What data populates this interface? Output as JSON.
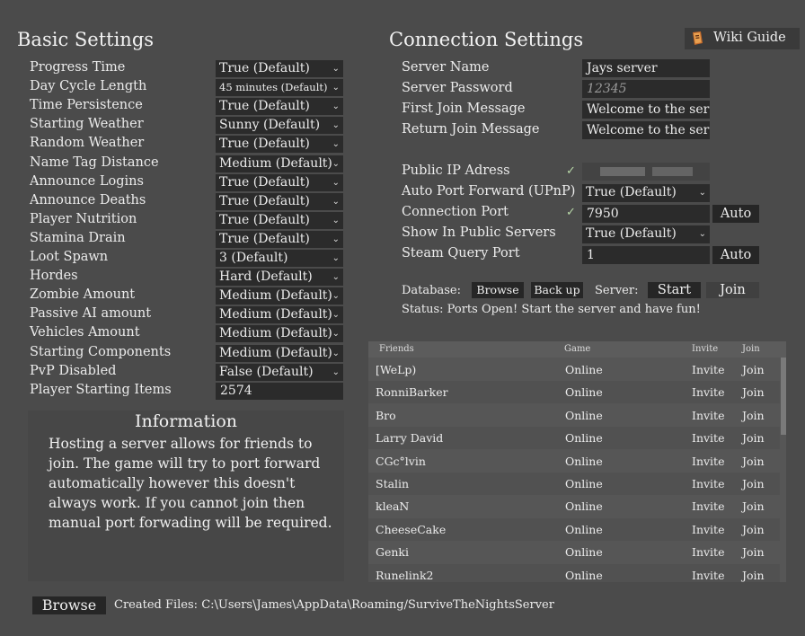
{
  "basic": {
    "title": "Basic Settings",
    "rows": [
      {
        "label": "Progress Time",
        "value": "True (Default)",
        "type": "dropdown"
      },
      {
        "label": "Day Cycle Length",
        "value": "45 minutes (Default)",
        "type": "dropdown",
        "small": true
      },
      {
        "label": "Time Persistence",
        "value": "True (Default)",
        "type": "dropdown"
      },
      {
        "label": "Starting Weather",
        "value": "Sunny (Default)",
        "type": "dropdown"
      },
      {
        "label": "Random Weather",
        "value": "True (Default)",
        "type": "dropdown"
      },
      {
        "label": "Name Tag Distance",
        "value": "Medium (Default)",
        "type": "dropdown"
      },
      {
        "label": "Announce Logins",
        "value": "True (Default)",
        "type": "dropdown"
      },
      {
        "label": "Announce Deaths",
        "value": "True (Default)",
        "type": "dropdown"
      },
      {
        "label": "Player Nutrition",
        "value": "True (Default)",
        "type": "dropdown"
      },
      {
        "label": "Stamina Drain",
        "value": "True (Default)",
        "type": "dropdown"
      },
      {
        "label": "Loot Spawn",
        "value": "3 (Default)",
        "type": "dropdown"
      },
      {
        "label": "Hordes",
        "value": "Hard (Default)",
        "type": "dropdown"
      },
      {
        "label": "Zombie Amount",
        "value": "Medium (Default)",
        "type": "dropdown"
      },
      {
        "label": "Passive AI amount",
        "value": "Medium (Default)",
        "type": "dropdown"
      },
      {
        "label": "Vehicles Amount",
        "value": "Medium (Default)",
        "type": "dropdown"
      },
      {
        "label": "Starting Components",
        "value": "Medium (Default)",
        "type": "dropdown"
      },
      {
        "label": "PvP Disabled",
        "value": "False (Default)",
        "type": "dropdown"
      },
      {
        "label": "Player Starting Items",
        "value": "2574",
        "type": "input"
      }
    ]
  },
  "info": {
    "title": "Information",
    "text": "Hosting a server allows for friends to join. The game will try to port forward automatically however this doesn't always work. If you cannot join then manual port forwading will be required."
  },
  "connection": {
    "title": "Connection Settings",
    "wiki_label": "Wiki Guide",
    "server_name_label": "Server Name",
    "server_name_value": "Jays server",
    "server_password_label": "Server Password",
    "server_password_placeholder": "12345",
    "first_join_label": "First Join Message",
    "first_join_value": "Welcome to the ser",
    "return_join_label": "Return Join Message",
    "return_join_value": "Welcome to the ser",
    "public_ip_label": "Public IP Adress",
    "auto_port_label": "Auto Port Forward (UPnP)",
    "auto_port_value": "True (Default)",
    "connection_port_label": "Connection Port",
    "connection_port_value": "7950",
    "show_public_label": "Show In Public Servers",
    "show_public_value": "True (Default)",
    "steam_query_label": "Steam Query Port",
    "steam_query_value": "1",
    "auto_label": "Auto",
    "database_label": "Database:",
    "browse_label": "Browse",
    "backup_label": "Back up",
    "server_label": "Server:",
    "start_label": "Start",
    "join_label": "Join",
    "status_text": "Status: Ports Open! Start the server and have fun!"
  },
  "friends": {
    "headers": {
      "name": "Friends",
      "game": "Game",
      "invite": "Invite",
      "join": "Join"
    },
    "rows": [
      {
        "name": "[WeLp)",
        "game": "Online",
        "invite": "Invite",
        "join": "Join"
      },
      {
        "name": "RonniBarker",
        "game": "Online",
        "invite": "Invite",
        "join": "Join"
      },
      {
        "name": "Bro",
        "game": "Online",
        "invite": "Invite",
        "join": "Join"
      },
      {
        "name": "Larry David",
        "game": "Online",
        "invite": "Invite",
        "join": "Join"
      },
      {
        "name": "CGc°lvin",
        "game": "Online",
        "invite": "Invite",
        "join": "Join"
      },
      {
        "name": "Stalin",
        "game": "Online",
        "invite": "Invite",
        "join": "Join"
      },
      {
        "name": "kleaN",
        "game": "Online",
        "invite": "Invite",
        "join": "Join"
      },
      {
        "name": "CheeseCake",
        "game": "Online",
        "invite": "Invite",
        "join": "Join"
      },
      {
        "name": "Genki",
        "game": "Online",
        "invite": "Invite",
        "join": "Join"
      },
      {
        "name": "Runelink2",
        "game": "Online",
        "invite": "Invite",
        "join": "Join"
      }
    ]
  },
  "footer": {
    "browse_label": "Browse",
    "created_files_text": "Created Files: C:\\Users\\James\\AppData\\Roaming/SurviveTheNightsServer"
  }
}
